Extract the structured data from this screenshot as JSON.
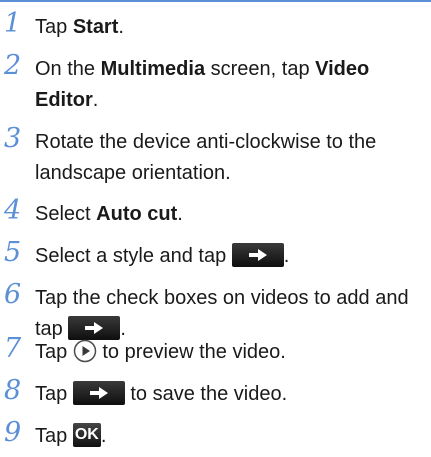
{
  "accent_color": "#5b8fd6",
  "steps": [
    {
      "number": "1",
      "parts": {
        "a": "Tap ",
        "b": "Start",
        "c": "."
      }
    },
    {
      "number": "2",
      "parts": {
        "a": "On the ",
        "b": "Multimedia",
        "c": " screen, tap ",
        "d": "Video Editor",
        "e": "."
      }
    },
    {
      "number": "3",
      "parts": {
        "a": "Rotate the device anti-clockwise to the landscape orientation."
      }
    },
    {
      "number": "4",
      "parts": {
        "a": "Select ",
        "b": "Auto cut",
        "c": "."
      }
    },
    {
      "number": "5",
      "parts": {
        "a": "Select a style and tap ",
        "icon": "right-arrow-button",
        "c": "."
      }
    },
    {
      "number": "6",
      "parts": {
        "a": "Tap the check boxes on videos to add and tap ",
        "icon": "right-arrow-button",
        "c": "."
      }
    },
    {
      "number": "7",
      "parts": {
        "a": "Tap ",
        "icon": "play-icon",
        "c": " to preview the video."
      }
    },
    {
      "number": "8",
      "parts": {
        "a": "Tap ",
        "icon": "right-arrow-button",
        "c": " to save the video."
      }
    },
    {
      "number": "9",
      "parts": {
        "a": "Tap ",
        "ok_label": "OK",
        "c": "."
      }
    }
  ]
}
